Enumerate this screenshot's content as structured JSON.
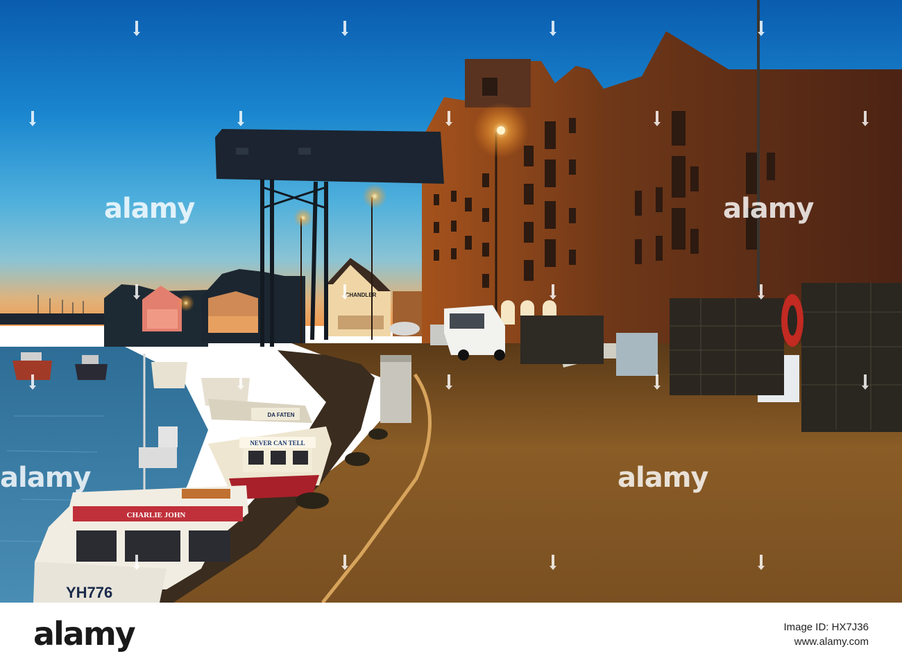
{
  "watermark": {
    "text": "alamy"
  },
  "boat_names": {
    "front": "CHARLIE JOHN",
    "middle": "NEVER CAN TELL",
    "rear": "DA FATEN"
  },
  "boat_number": "YH776",
  "shop_sign": "CHANDLER",
  "footer": {
    "logo": "alamy",
    "image_id_label": "Image ID: HX7J36",
    "url": "www.alamy.com"
  },
  "colors": {
    "sky_top": "#0b5fb0",
    "sky_horizon": "#f0a050",
    "water": "#3f7ea6",
    "quay": "#8a5a25",
    "brick": "#6a3418",
    "lamp_glow": "#ffb040"
  }
}
